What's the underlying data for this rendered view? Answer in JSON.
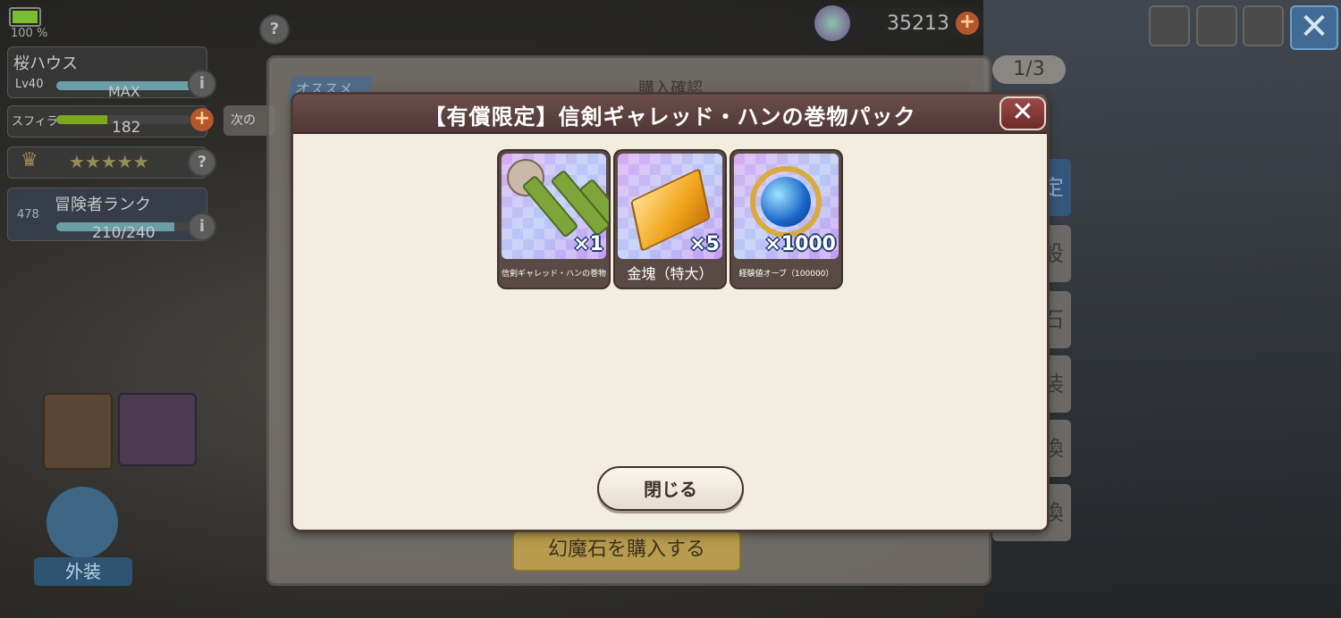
{
  "status": {
    "battery_pct": 100,
    "battery_label": "100 %"
  },
  "player": {
    "name": "桜ハウス",
    "level": "Lv40",
    "level_max": "MAX",
    "stamina_label": "スフィラ",
    "stamina_value": "182",
    "next_label": "次の",
    "stars": "★★★★★",
    "rank_label": "冒険者ランク",
    "rank_number": "478",
    "rank_exp": "210/240"
  },
  "currency": {
    "amount": "35213",
    "add_symbol": "+"
  },
  "background_window": {
    "page_count": "1/3",
    "tab_partial": "オススメ",
    "title_partial": "購入確認",
    "right_tabs": [
      "限定",
      "設",
      "石",
      "装",
      "換",
      "換"
    ],
    "buy_button": "幻魔石を購入する",
    "skin_label": "外装"
  },
  "dialog": {
    "title": "【有償限定】信剣ギャレッド・ハンの巻物パック",
    "close_symbol": "✕",
    "items": [
      {
        "name": "信剣ギャレッド・ハンの巻物",
        "quantity": "×1",
        "icon": "scroll-bundle-icon"
      },
      {
        "name": "金塊（特大）",
        "quantity": "×5",
        "icon": "gold-bar-icon"
      },
      {
        "name": "経験値オーブ（100000）",
        "quantity": "×1000",
        "icon": "exp-orb-icon"
      }
    ],
    "close_button": "閉じる"
  },
  "colors": {
    "dialog_bg": "#f3ede0",
    "header_bg": "#5c4240",
    "close_red": "#8a3a38",
    "card_bg": "#5a4a45"
  }
}
